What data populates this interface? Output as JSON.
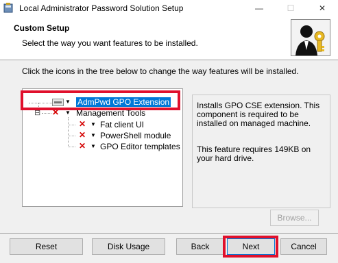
{
  "window": {
    "title": "Local Administrator Password Solution Setup",
    "minimize_glyph": "—",
    "maximize_glyph": "☐",
    "close_glyph": "✕"
  },
  "header": {
    "title": "Custom Setup",
    "subtitle": "Select the way you want features to be installed."
  },
  "instruction": "Click the icons in the tree below to change the way features will be installed.",
  "tree": {
    "items": [
      {
        "label": "AdmPwd GPO Extension",
        "state": "will-be-installed",
        "selected": true
      },
      {
        "label": "Management Tools",
        "state": "not-available",
        "expand_glyph": "⊟"
      },
      {
        "label": "Fat client UI",
        "state": "not-available"
      },
      {
        "label": "PowerShell module",
        "state": "not-available"
      },
      {
        "label": "GPO Editor templates",
        "state": "not-available"
      }
    ],
    "x_glyph": "✕",
    "dropdown_glyph": "▼"
  },
  "description": {
    "text": "Installs GPO CSE extension. This component is required to be installed on managed machine.",
    "size_text": "This feature requires 149KB on your hard drive."
  },
  "buttons": {
    "browse": "Browse...",
    "reset": "Reset",
    "disk_usage": "Disk Usage",
    "back": "Back",
    "next": "Next",
    "cancel": "Cancel"
  },
  "colors": {
    "highlight_red": "#e0102c",
    "selection_blue": "#0078d7",
    "x_red": "#d40000"
  }
}
